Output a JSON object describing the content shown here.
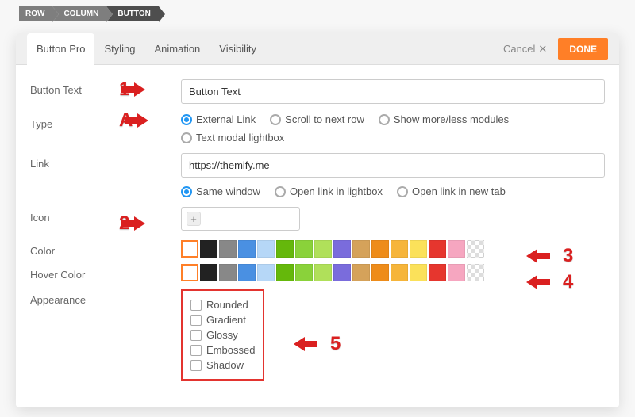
{
  "breadcrumb": [
    "ROW",
    "COLUMN",
    "BUTTON"
  ],
  "tabs": [
    {
      "label": "Button Pro",
      "active": true
    },
    {
      "label": "Styling",
      "active": false
    },
    {
      "label": "Animation",
      "active": false
    },
    {
      "label": "Visibility",
      "active": false
    }
  ],
  "actions": {
    "cancel": "Cancel",
    "done": "DONE"
  },
  "fields": {
    "button_text": {
      "label": "Button Text",
      "value": "Button Text"
    },
    "type": {
      "label": "Type",
      "options": [
        {
          "label": "External Link",
          "checked": true
        },
        {
          "label": "Scroll to next row",
          "checked": false
        },
        {
          "label": "Show more/less modules",
          "checked": false
        },
        {
          "label": "Text modal lightbox",
          "checked": false
        }
      ]
    },
    "link": {
      "label": "Link",
      "value": "https://themify.me"
    },
    "link_target": {
      "options": [
        {
          "label": "Same window",
          "checked": true
        },
        {
          "label": "Open link in lightbox",
          "checked": false
        },
        {
          "label": "Open link in new tab",
          "checked": false
        }
      ]
    },
    "icon": {
      "label": "Icon",
      "value": ""
    },
    "color": {
      "label": "Color"
    },
    "hover_color": {
      "label": "Hover Color"
    },
    "appearance": {
      "label": "Appearance",
      "options": [
        "Rounded",
        "Gradient",
        "Glossy",
        "Embossed",
        "Shadow"
      ]
    }
  },
  "palette": [
    "#ffffff",
    "#222222",
    "#888888",
    "#4a90e2",
    "#b6d7f7",
    "#65b80b",
    "#8ad23a",
    "#b0e05a",
    "#7a6cdc",
    "#d5a25a",
    "#ee8c1a",
    "#f6b53a",
    "#fbe15a",
    "#e6362e",
    "#f6a6c0",
    "transparent"
  ],
  "annotations": {
    "a1": "1",
    "aA": "A",
    "a2": "2",
    "a3": "3",
    "a4": "4",
    "a5": "5"
  }
}
